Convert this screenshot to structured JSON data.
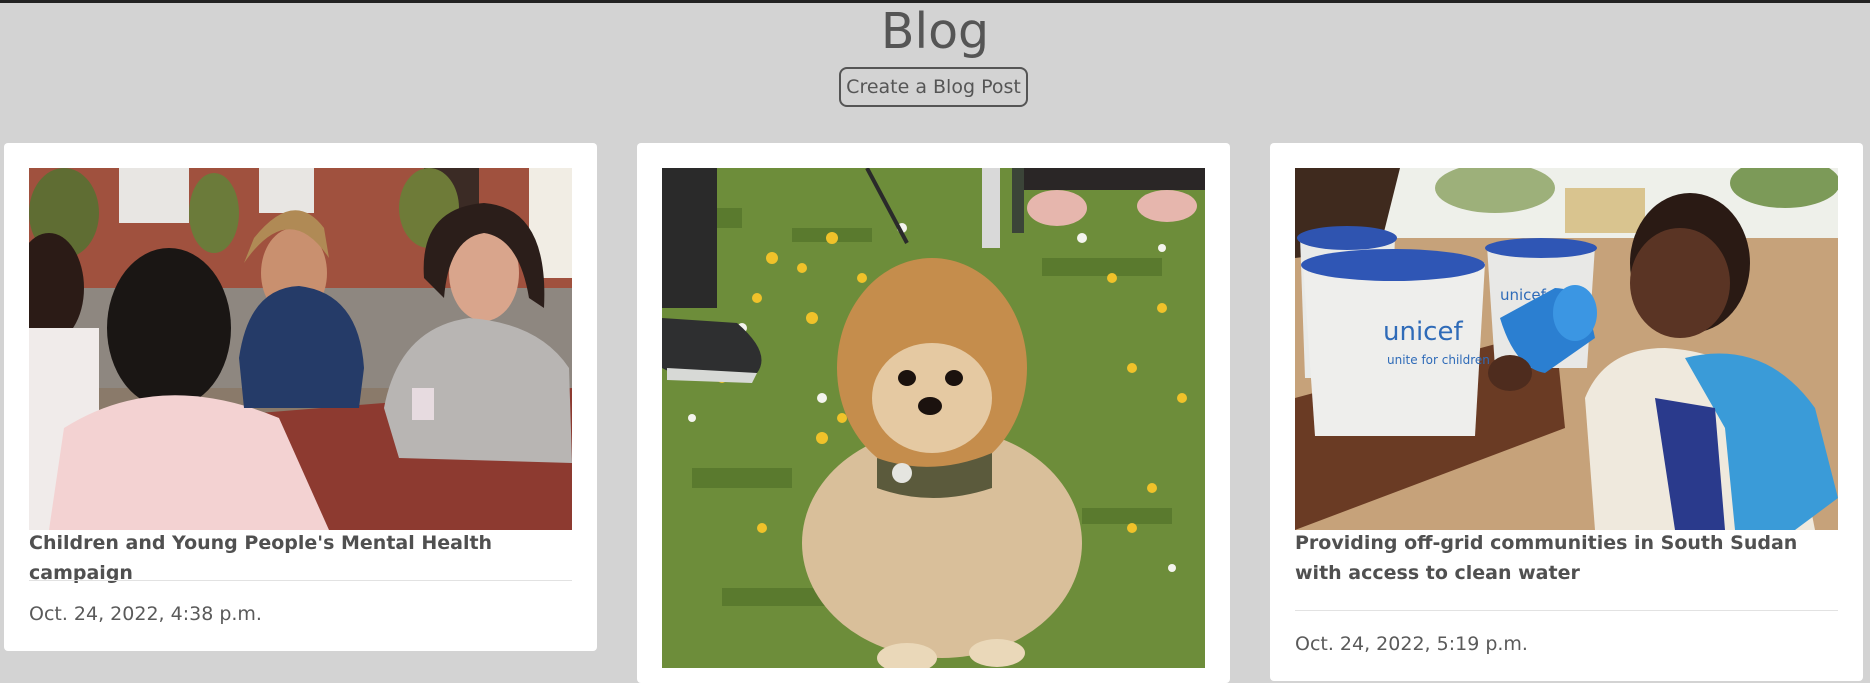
{
  "page": {
    "title": "Blog",
    "create_button_label": "Create a Blog Post"
  },
  "posts": [
    {
      "title": "Children and Young People's Mental Health campaign",
      "date": "Oct. 24, 2022, 4:38 p.m.",
      "image": "photo-young-people-talking-at-bench"
    },
    {
      "title": "",
      "date": "",
      "image": "photo-pomeranian-dog-on-grass"
    },
    {
      "title": "Providing off-grid communities in South Sudan with access to clean water",
      "date": "Oct. 24, 2022, 5:19 p.m.",
      "image": "photo-child-drinking-from-unicef-cup",
      "image_text": {
        "logo": "unicef",
        "tagline": "unite for children"
      }
    }
  ],
  "colors": {
    "page_background": "#d3d3d3",
    "card_background": "#ffffff",
    "text": "#4a4a4a"
  }
}
